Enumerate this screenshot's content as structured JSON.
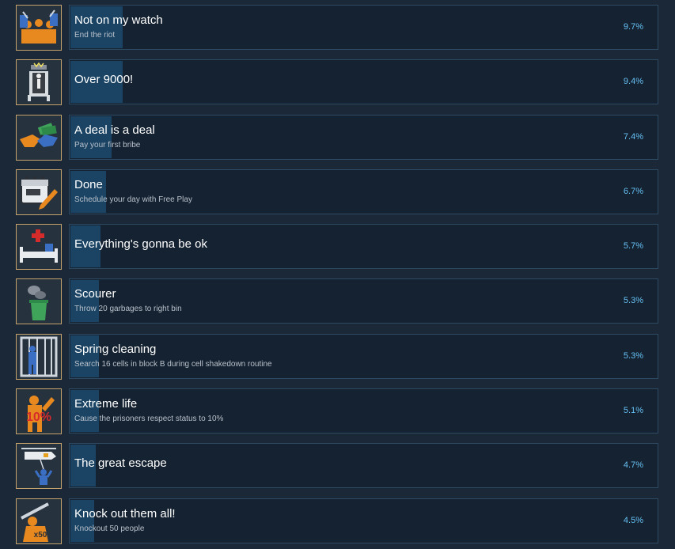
{
  "achievements": [
    {
      "title": "Not on my watch",
      "description": "End the riot",
      "percent": "9.7%",
      "percent_value": 9.7,
      "icon": "riot-guards-icon"
    },
    {
      "title": "Over 9000!",
      "description": "",
      "percent": "9.4%",
      "percent_value": 9.4,
      "icon": "electric-chair-icon"
    },
    {
      "title": "A deal is a deal",
      "description": "Pay your first bribe",
      "percent": "7.4%",
      "percent_value": 7.4,
      "icon": "handshake-money-icon"
    },
    {
      "title": "Done",
      "description": "Schedule your day with Free Play",
      "percent": "6.7%",
      "percent_value": 6.7,
      "icon": "calendar-pencil-icon"
    },
    {
      "title": "Everything's gonna be ok",
      "description": "",
      "percent": "5.7%",
      "percent_value": 5.7,
      "icon": "hospital-bed-icon"
    },
    {
      "title": "Scourer",
      "description": "Throw 20 garbages to right bin",
      "percent": "5.3%",
      "percent_value": 5.3,
      "icon": "garbage-bin-icon"
    },
    {
      "title": "Spring cleaning",
      "description": "Search 16 cells in block B during cell shakedown routine",
      "percent": "5.3%",
      "percent_value": 5.3,
      "icon": "prison-cell-icon"
    },
    {
      "title": "Extreme life",
      "description": "Cause the prisoners respect status to 10%",
      "percent": "5.1%",
      "percent_value": 5.1,
      "icon": "prisoner-10-percent-icon",
      "icon_text": "10%"
    },
    {
      "title": "The great escape",
      "description": "",
      "percent": "4.7%",
      "percent_value": 4.7,
      "icon": "helicopter-escape-icon"
    },
    {
      "title": "Knock out them all!",
      "description": "Knockout 50 people",
      "percent": "4.5%",
      "percent_value": 4.5,
      "icon": "knockout-x50-icon",
      "icon_text": "x50"
    }
  ],
  "colors": {
    "background": "#1b2838",
    "card": "#152231",
    "card_border": "#2e4a63",
    "progress_fill": "#1b4464",
    "icon_border": "#c6a36b",
    "percent_text": "#66c0f4",
    "description_text": "#b8c0ca"
  }
}
